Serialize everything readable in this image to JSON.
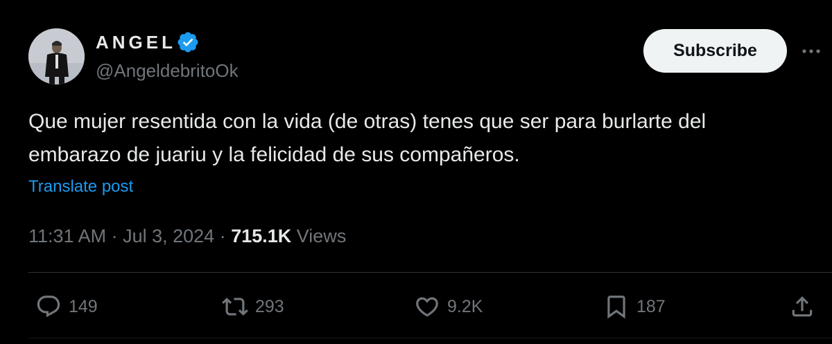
{
  "author": {
    "display_name": "ANGEL",
    "handle": "@AngeldebritoOk",
    "verified": true
  },
  "subscribe_label": "Subscribe",
  "text_lines": [
    "Que mujer resentida con la vida (de otras) tenes que ser para burlarte del",
    "embarazo de juariu y la felicidad de sus compañeros."
  ],
  "translate_label": "Translate post",
  "meta": {
    "time": "11:31 AM",
    "separator": " · ",
    "date": "Jul 3, 2024",
    "views_count": "715.1K",
    "views_label": "Views"
  },
  "actions": {
    "replies": "149",
    "reposts": "293",
    "likes": "9.2K",
    "bookmarks": "187"
  },
  "colors": {
    "background": "#000000",
    "text": "#e7e9ea",
    "muted": "#71767b",
    "link": "#1d9bf0",
    "verified": "#1d9bf0",
    "button_bg": "#eff3f4"
  }
}
